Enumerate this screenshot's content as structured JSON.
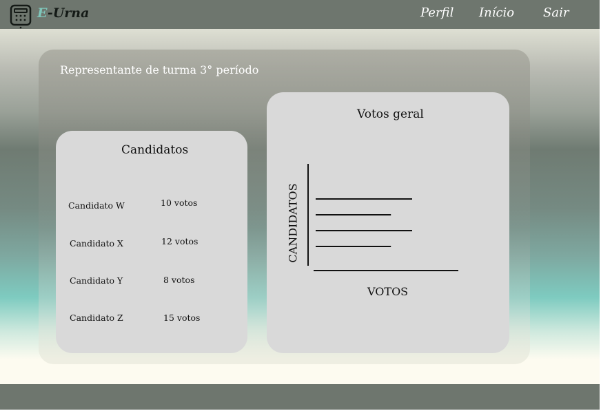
{
  "header": {
    "brand_prefix": "E",
    "brand_suffix": "-Urna",
    "nav": [
      {
        "label": "Perfil"
      },
      {
        "label": "Início"
      },
      {
        "label": "Sair"
      }
    ]
  },
  "main": {
    "title": "Representante de turma 3° período",
    "candidatos_card": {
      "title": "Candidatos",
      "rows": [
        {
          "name": "Candidato W",
          "votes": "10 votos"
        },
        {
          "name": "Candidato X",
          "votes": "12 votos"
        },
        {
          "name": "Candidato Y",
          "votes": "8 votos"
        },
        {
          "name": "Candidato Z",
          "votes": "15 votos"
        }
      ]
    },
    "votos_card": {
      "title": "Votos geral"
    }
  },
  "chart_data": {
    "type": "bar",
    "orientation": "horizontal",
    "title": "Votos geral",
    "xlabel": "VOTOS",
    "ylabel": "CANDIDATOS",
    "bars": [
      {
        "value": 1.0
      },
      {
        "value": 0.78
      },
      {
        "value": 1.0
      },
      {
        "value": 0.78
      }
    ],
    "grid": false
  },
  "colors": {
    "header_bg": "#6e766e",
    "brand_accent": "#7fc7bb",
    "card_bg": "#d9d9d9"
  },
  "icons": {
    "logo": "calculator-icon"
  }
}
